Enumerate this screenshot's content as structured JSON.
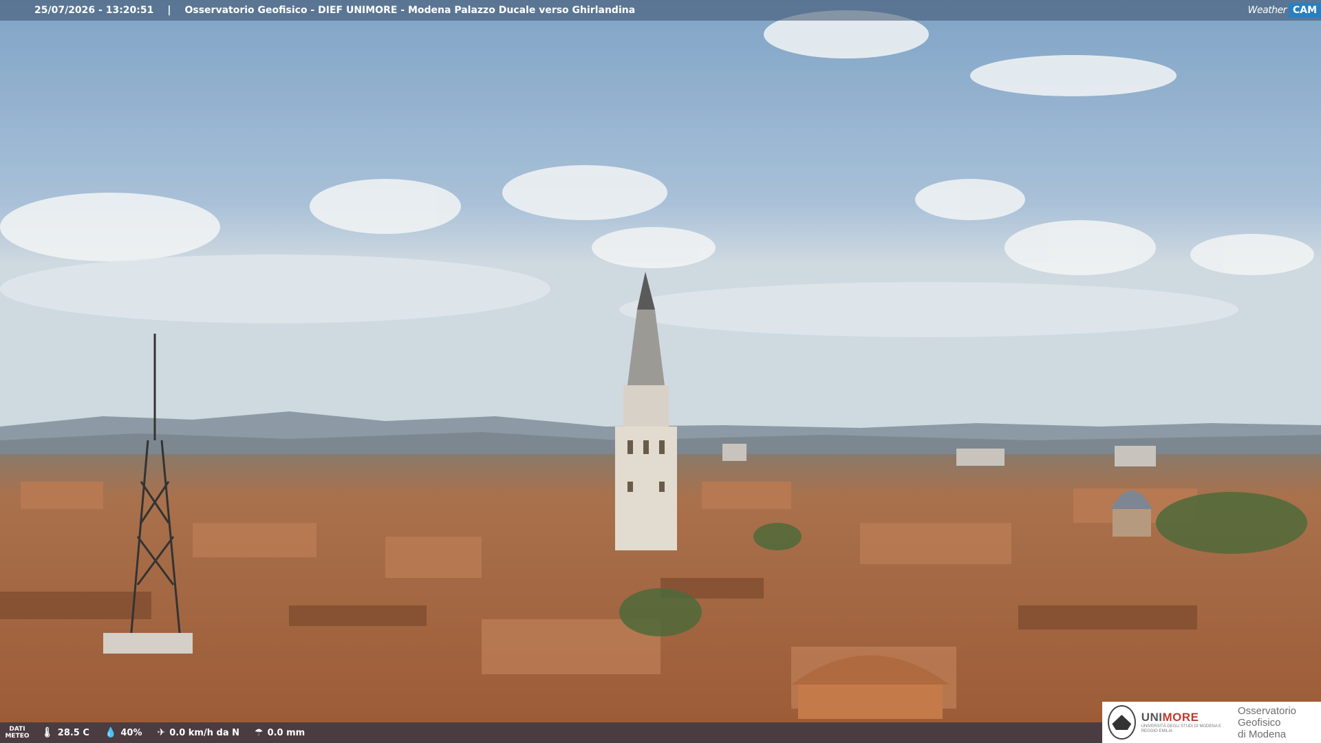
{
  "header": {
    "timestamp": "25/07/2026 - 13:20:51",
    "separator": "|",
    "location": "Osservatorio Geofisico - DIEF UNIMORE - Modena Palazzo Ducale verso Ghirlandina"
  },
  "brand": {
    "weathercam_left": "Weather",
    "weathercam_right": "CAM",
    "unimore_a": "UNI",
    "unimore_b": "MORE",
    "unimore_sub": "UNIVERSITÀ DEGLI STUDI DI MODENA E REGGIO EMILIA",
    "observatory_line1": "Osservatorio Geofisico",
    "observatory_line2": "di Modena"
  },
  "meteo": {
    "label_line1": "DATI",
    "label_line2": "METEO",
    "temperature": "28.5 C",
    "humidity": "40%",
    "wind": "0.0 km/h da N",
    "rain": "0.0 mm"
  },
  "icons": {
    "temperature": "thermometer-icon",
    "humidity": "droplet-icon",
    "wind": "wind-icon",
    "rain": "umbrella-icon"
  },
  "colors": {
    "accent": "#2a7fbf",
    "unimore_red": "#c0392b"
  }
}
